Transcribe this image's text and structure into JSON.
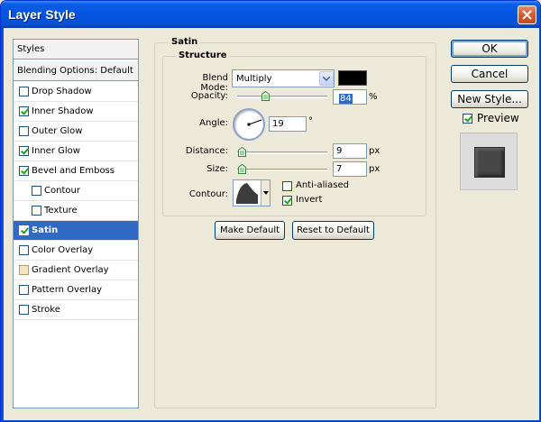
{
  "window": {
    "title": "Layer Style"
  },
  "styles_list": {
    "header": "Styles",
    "blending_options": "Blending Options: Default",
    "items": [
      {
        "label": "Drop Shadow",
        "checked": false,
        "indent": false,
        "selected": false
      },
      {
        "label": "Inner Shadow",
        "checked": true,
        "indent": false,
        "selected": false
      },
      {
        "label": "Outer Glow",
        "checked": false,
        "indent": false,
        "selected": false
      },
      {
        "label": "Inner Glow",
        "checked": true,
        "indent": false,
        "selected": false
      },
      {
        "label": "Bevel and Emboss",
        "checked": true,
        "indent": false,
        "selected": false
      },
      {
        "label": "Contour",
        "checked": false,
        "indent": true,
        "selected": false
      },
      {
        "label": "Texture",
        "checked": false,
        "indent": true,
        "selected": false
      },
      {
        "label": "Satin",
        "checked": true,
        "indent": false,
        "selected": true
      },
      {
        "label": "Color Overlay",
        "checked": false,
        "indent": false,
        "selected": false
      },
      {
        "label": "Gradient Overlay",
        "checked": false,
        "indent": false,
        "selected": false
      },
      {
        "label": "Pattern Overlay",
        "checked": false,
        "indent": false,
        "selected": false
      },
      {
        "label": "Stroke",
        "checked": false,
        "indent": false,
        "selected": false
      }
    ]
  },
  "satin": {
    "group_title": "Satin",
    "structure_title": "Structure",
    "blend_mode_label": "Blend Mode:",
    "blend_mode_value": "Multiply",
    "color": "#000000",
    "opacity_label": "Opacity:",
    "opacity_value": "84",
    "opacity_unit": "%",
    "angle_label": "Angle:",
    "angle_value": "19",
    "angle_unit": "°",
    "distance_label": "Distance:",
    "distance_value": "9",
    "distance_unit": "px",
    "size_label": "Size:",
    "size_value": "7",
    "size_unit": "px",
    "contour_label": "Contour:",
    "anti_aliased_label": "Anti-aliased",
    "anti_aliased": false,
    "invert_label": "Invert",
    "invert": true
  },
  "buttons": {
    "make_default": "Make Default",
    "reset_to_default": "Reset to Default",
    "ok": "OK",
    "cancel": "Cancel",
    "new_style": "New Style...",
    "preview_label": "Preview"
  },
  "colors": {
    "titlebar": "#0554e2",
    "selection": "#316ac5",
    "checkmark": "#21a121"
  }
}
